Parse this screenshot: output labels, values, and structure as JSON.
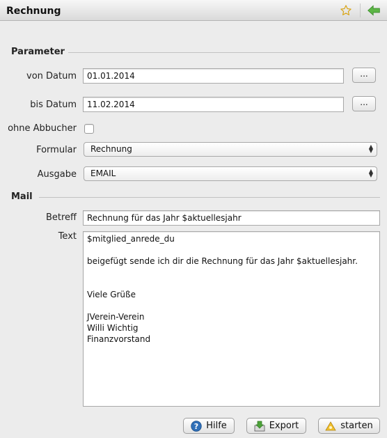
{
  "window": {
    "title": "Rechnung",
    "icons": [
      "star-icon",
      "back-arrow-icon"
    ]
  },
  "parameter": {
    "section_title": "Parameter",
    "von_datum": {
      "label": "von Datum",
      "value": "01.01.2014",
      "button": "..."
    },
    "bis_datum": {
      "label": "bis Datum",
      "value": "11.02.2014",
      "button": "..."
    },
    "ohne_abbucher": {
      "label": "ohne Abbucher",
      "checked": false
    },
    "formular": {
      "label": "Formular",
      "selected": "Rechnung"
    },
    "ausgabe": {
      "label": "Ausgabe",
      "selected": "EMAIL"
    }
  },
  "mail": {
    "section_title": "Mail",
    "betreff": {
      "label": "Betreff",
      "value": "Rechnung für das Jahr $aktuellesjahr"
    },
    "text": {
      "label": "Text",
      "value": "$mitglied_anrede_du\n\nbeigefügt sende ich dir die Rechnung für das Jahr $aktuellesjahr.\n\n\nViele Grüße\n\nJVerein-Verein\nWilli Wichtig\nFinanzvorstand"
    }
  },
  "buttons": {
    "hilfe": "Hilfe",
    "export": "Export",
    "starten": "starten"
  },
  "colors": {
    "background": "#ececec",
    "field_border": "#a9a9a9",
    "star": "#d8a416",
    "arrow": "#4da23a"
  }
}
